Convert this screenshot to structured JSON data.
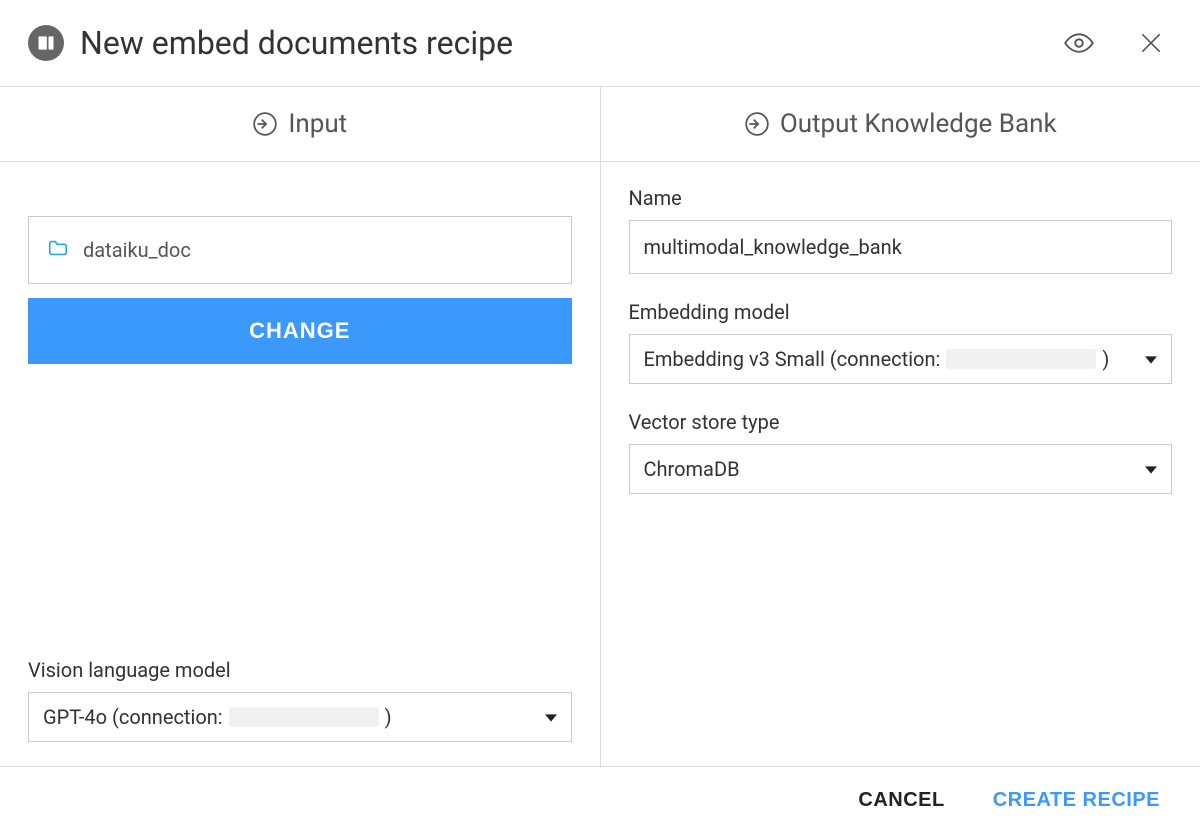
{
  "header": {
    "title": "New embed documents recipe"
  },
  "columns": {
    "input_label": "Input",
    "output_label": "Output Knowledge Bank"
  },
  "input": {
    "dataset_name": "dataiku_doc",
    "change_button": "CHANGE",
    "vision_model_label": "Vision language model",
    "vision_model_prefix": "GPT-4o (connection:",
    "vision_model_suffix": ")"
  },
  "output": {
    "name_label": "Name",
    "name_value": "multimodal_knowledge_bank",
    "embedding_label": "Embedding model",
    "embedding_prefix": "Embedding v3 Small (connection:",
    "embedding_suffix": ")",
    "vector_store_label": "Vector store type",
    "vector_store_value": "ChromaDB"
  },
  "footer": {
    "cancel": "CANCEL",
    "create": "CREATE RECIPE"
  }
}
